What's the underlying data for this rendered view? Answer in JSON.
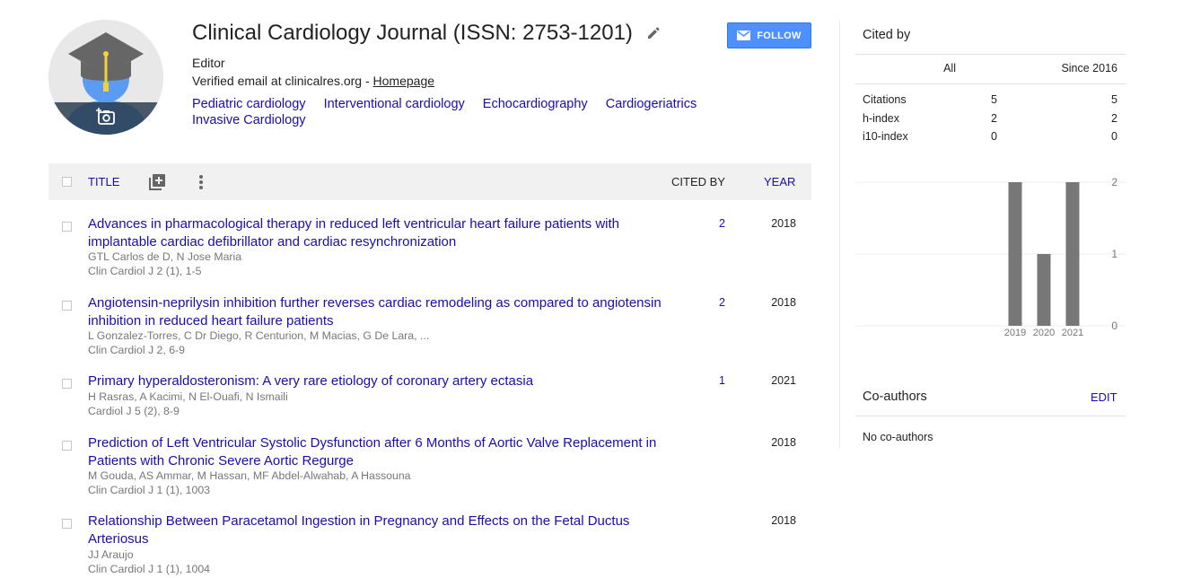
{
  "profile": {
    "name": "Clinical Cardiology Journal (ISSN: 2753-1201)",
    "affiliation": "Editor",
    "verified_text": "Verified email at clinicalres.org - ",
    "homepage_label": "Homepage",
    "follow_label": "FOLLOW",
    "interests": [
      "Pediatric cardiology",
      "Interventional cardiology",
      "Echocardiography",
      "Cardiogeriatrics",
      "Invasive Cardiology"
    ]
  },
  "table": {
    "header": {
      "title": "TITLE",
      "cited_by": "CITED BY",
      "year": "YEAR"
    },
    "rows": [
      {
        "title": "Advances in pharmacological therapy in reduced left ventricular heart failure patients with implantable cardiac defibrillator and cardiac resynchronization",
        "authors": "GTL Carlos de D, N Jose Maria",
        "venue": "Clin Cardiol J 2 (1), 1-5",
        "cited_by": "2",
        "year": "2018"
      },
      {
        "title": "Angiotensin-neprilysin inhibition further reverses cardiac remodeling as compared to angiotensin inhibition in reduced heart failure patients",
        "authors": "L Gonzalez-Torres, C Dr Diego, R Centurion, M Macias, G De Lara, ...",
        "venue": "Clin Cardiol J 2, 6-9",
        "cited_by": "2",
        "year": "2018"
      },
      {
        "title": "Primary hyperaldosteronism: A very rare etiology of coronary artery ectasia",
        "authors": "H Rasras, A Kacimi, N El-Ouafi, N Ismaili",
        "venue": "Cardiol J 5 (2), 8-9",
        "cited_by": "1",
        "year": "2021"
      },
      {
        "title": "Prediction of Left Ventricular Systolic Dysfunction after 6 Months of Aortic Valve Replacement in Patients with Chronic Severe Aortic Regurge",
        "authors": "M Gouda, AS Ammar, M Hassan, MF Abdel-Alwahab, A Hassouna",
        "venue": "Clin Cardiol J 1 (1), 1003",
        "cited_by": "",
        "year": "2018"
      },
      {
        "title": "Relationship Between Paracetamol Ingestion in Pregnancy and Effects on the Fetal Ductus Arteriosus",
        "authors": "JJ Araujo",
        "venue": "Clin Cardiol J 1 (1), 1004",
        "cited_by": "",
        "year": "2018"
      }
    ]
  },
  "cited_by": {
    "title": "Cited by",
    "col_all": "All",
    "col_since": "Since 2016",
    "metrics": [
      {
        "label": "Citations",
        "all": "5",
        "since": "5"
      },
      {
        "label": "h-index",
        "all": "2",
        "since": "2"
      },
      {
        "label": "i10-index",
        "all": "0",
        "since": "0"
      }
    ]
  },
  "chart_data": {
    "type": "bar",
    "categories": [
      "2019",
      "2020",
      "2021"
    ],
    "values": [
      2,
      1,
      2
    ],
    "ylim": [
      0,
      2
    ],
    "yticks": [
      "2",
      "1",
      "0"
    ],
    "bar_color": "#777777"
  },
  "coauthors": {
    "title": "Co-authors",
    "edit_label": "EDIT",
    "empty_text": "No co-authors"
  },
  "colors": {
    "link": "#1a0dab",
    "accent": "#4d90fe",
    "muted": "#777777"
  }
}
